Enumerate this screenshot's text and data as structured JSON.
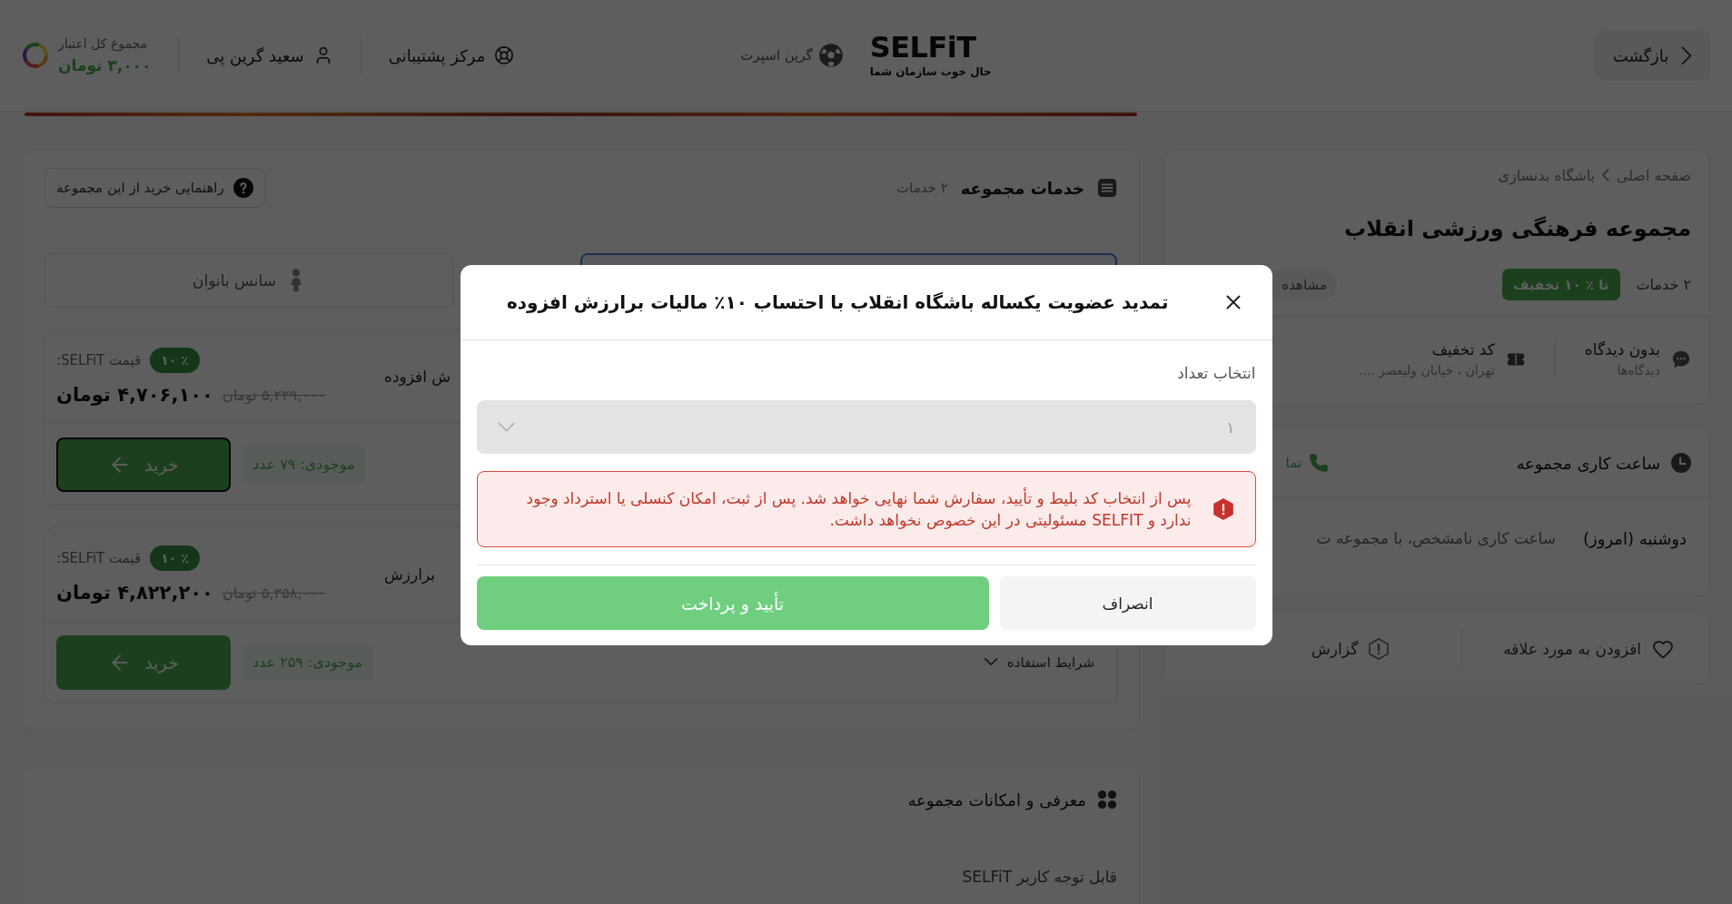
{
  "header": {
    "back_button": "بازگشت",
    "brand": {
      "name": "SELFiT",
      "tagline": "حال خوب سازمان شما"
    },
    "partner": "گرین اسپرت",
    "support": "مرکز پشتیبانی",
    "user_name": "سعید گرین پی",
    "credit": {
      "label": "مجموع کل اعتبار",
      "amount": "۳,۰۰۰ تومان"
    }
  },
  "venue": {
    "breadcrumb": [
      "صفحه اصلی",
      "باشگاه بدنسازی"
    ],
    "title": "مجموعه فرهنگی ورزشی انقلاب",
    "services_count": "۲ خدمات",
    "discount": "تا ٪ ۱۰ تخفیف",
    "view_chip": "مشاهده",
    "stats": [
      {
        "kind": "comments",
        "title": "بدون دیدگاه",
        "subtitle": "دیدگاه‌ها"
      },
      {
        "kind": "coupon",
        "title": "کد تخفیف",
        "subtitle": "تهران ، خیابان ولیعصر ...."
      }
    ]
  },
  "hours": {
    "title": "ساعت کاری مجموعه",
    "contact": "تما",
    "day": "دوشنبه (امروز)",
    "status": "ساعت کاری نامشخص، با مجموعه ت"
  },
  "actions": [
    {
      "kind": "favorite",
      "label": "افزودن به مورد علاقه"
    },
    {
      "kind": "report",
      "label": "گزارش"
    }
  ],
  "services": {
    "title": "خدمات مجموعه",
    "count": "۲ خدمات",
    "guide_button": "راهنمایی خرید از این مجموعه",
    "tabs": [
      {
        "selected": true
      },
      {
        "label": "سانس بانوان",
        "selected": false
      }
    ],
    "items": [
      {
        "title": "ش افزوده",
        "discount": "٪ ۱۰",
        "price_label": "قیمت SELFiT:",
        "old_price": "۵,۲۲۹,۰۰۰ تومان",
        "price": "۴,۷۰۶,۱۰۰ تومان",
        "stock": "موجودی: ۷۹ عدد",
        "buy_button": "خرید",
        "focused": true
      },
      {
        "title": "برارزش",
        "discount": "٪ ۱۰",
        "price_label": "قیمت SELFiT:",
        "old_price": "۵,۳۵۸,۰۰۰ تومان",
        "price": "۴,۸۲۲,۲۰۰ تومان",
        "terms": "شرایط استفاده",
        "stock": "موجودی: ۲۵۹ عدد",
        "buy_button": "خرید",
        "focused": false
      }
    ]
  },
  "intro": {
    "title": "معرفی و امکانات مجموعه",
    "text": "قابل توجه کاربر SELFiT"
  },
  "modal": {
    "title": "تمدید عضویت یکساله باشگاه انقلاب با احتساب ۱۰٪ مالیات برارزش افزوده",
    "quantity": {
      "label": "انتخاب تعداد",
      "value": "۱",
      "disabled": true
    },
    "warning": "پس از انتخاب کد بلیط و تأیید، سفارش شما نهایی خواهد شد. پس از ثبت، امکان کنسلی یا استرداد وجود ندارد و SELFIT مسئولیتی در این خصوص نخواهد داشت.",
    "buttons": [
      {
        "kind": "cancel",
        "label": "انصراف"
      },
      {
        "kind": "confirm",
        "label": "تأیید و پرداخت"
      }
    ]
  }
}
